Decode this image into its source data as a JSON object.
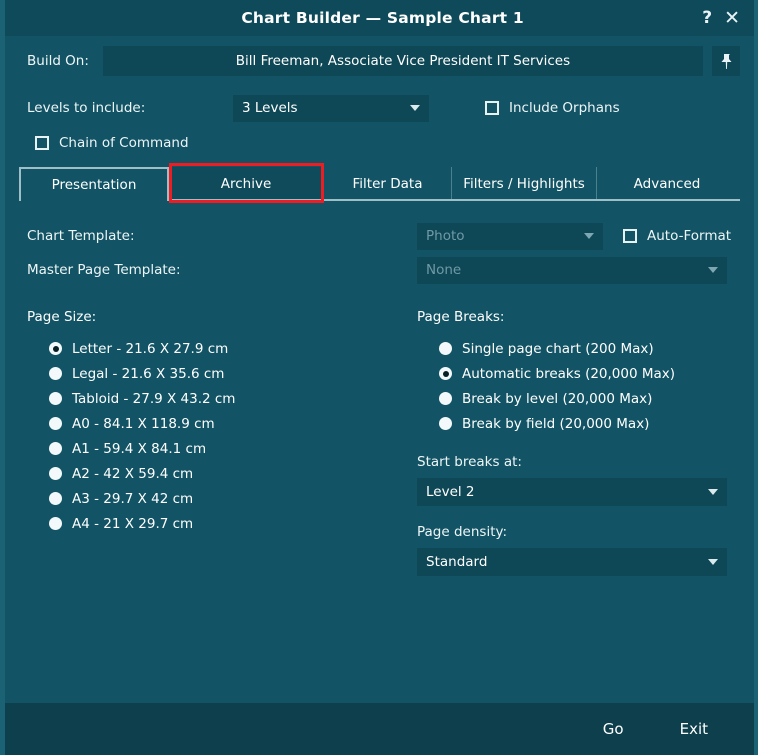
{
  "window": {
    "title": "Chart Builder — Sample Chart 1",
    "help_icon": "?",
    "close_icon": "✕",
    "accent_color": "#125465",
    "highlight_color": "#ee1d23"
  },
  "build_on": {
    "label": "Build On:",
    "value": "Bill Freeman, Associate Vice President IT Services",
    "pin_icon": "pushpin-icon"
  },
  "levels": {
    "label": "Levels to include:",
    "value": "3 Levels",
    "include_orphans_label": "Include Orphans",
    "include_orphans_checked": false,
    "chain_of_command_label": "Chain of Command",
    "chain_of_command_checked": false
  },
  "tabs": [
    {
      "label": "Presentation",
      "width": 150,
      "state": "selected"
    },
    {
      "label": "Archive",
      "width": 155,
      "state": "highlighted"
    },
    {
      "label": "Filter Data",
      "width": 128,
      "state": "normal"
    },
    {
      "label": "Filters / Highlights",
      "width": 145,
      "state": "normal"
    },
    {
      "label": "Advanced",
      "width": 140,
      "state": "normal"
    }
  ],
  "templates": {
    "chart_template_label": "Chart Template:",
    "chart_template_value": "Photo",
    "chart_template_disabled": true,
    "auto_format_label": "Auto-Format",
    "auto_format_checked": false,
    "master_template_label": "Master Page Template:",
    "master_template_value": "None",
    "master_template_disabled": true
  },
  "page_size": {
    "title": "Page Size:",
    "options": [
      {
        "label": "Letter - 21.6 X 27.9 cm",
        "checked": true
      },
      {
        "label": "Legal - 21.6 X 35.6 cm",
        "checked": false
      },
      {
        "label": "Tabloid - 27.9 X 43.2 cm",
        "checked": false
      },
      {
        "label": "A0 - 84.1 X 118.9 cm",
        "checked": false
      },
      {
        "label": "A1 - 59.4 X 84.1 cm",
        "checked": false
      },
      {
        "label": "A2 - 42 X 59.4 cm",
        "checked": false
      },
      {
        "label": "A3 - 29.7 X 42 cm",
        "checked": false
      },
      {
        "label": "A4 - 21 X 29.7 cm",
        "checked": false
      }
    ]
  },
  "page_breaks": {
    "title": "Page Breaks:",
    "options": [
      {
        "label": "Single page chart (200 Max)",
        "checked": false
      },
      {
        "label": "Automatic breaks (20,000 Max)",
        "checked": true
      },
      {
        "label": "Break by level (20,000 Max)",
        "checked": false
      },
      {
        "label": "Break by field (20,000 Max)",
        "checked": false
      }
    ],
    "start_breaks_label": "Start breaks at:",
    "start_breaks_value": "Level 2",
    "page_density_label": "Page density:",
    "page_density_value": "Standard"
  },
  "footer": {
    "go_label": "Go",
    "exit_label": "Exit"
  }
}
